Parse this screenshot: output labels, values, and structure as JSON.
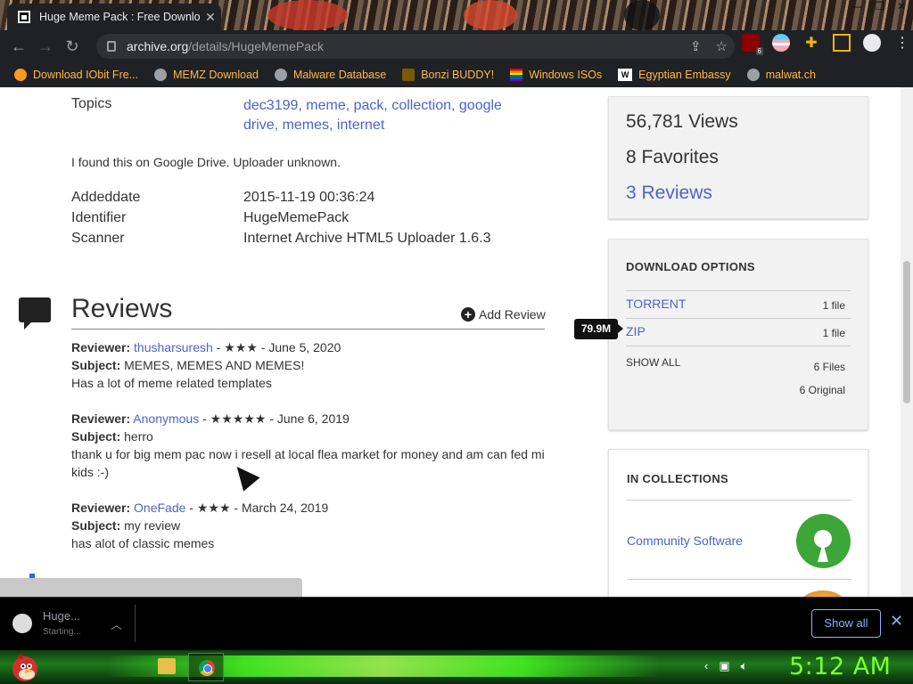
{
  "browser": {
    "tab_title": "Huge Meme Pack : Free Downloa",
    "tab_close": "✕",
    "url_host": "archive.org",
    "url_path": "/details/HugeMemePack",
    "ext_badge": "6"
  },
  "bookmarks": [
    {
      "label": "Download IObit Fre..."
    },
    {
      "label": "MEMZ Download"
    },
    {
      "label": "Malware Database"
    },
    {
      "label": "Bonzi BUDDY!"
    },
    {
      "label": "Windows ISOs"
    },
    {
      "label": "Egyptian Embassy"
    },
    {
      "label": "malwat.ch"
    }
  ],
  "meta": {
    "topics_label": "Topics",
    "topics": [
      "dec3199",
      "meme",
      "pack",
      "collection",
      "google drive",
      "memes",
      "internet"
    ],
    "description": "I found this on Google Drive. Uploader unknown.",
    "addeddate_label": "Addeddate",
    "addeddate": "2015-11-19 00:36:24",
    "identifier_label": "Identifier",
    "identifier": "HugeMemePack",
    "scanner_label": "Scanner",
    "scanner": "Internet Archive HTML5 Uploader 1.6.3"
  },
  "reviews": {
    "title": "Reviews",
    "add_label": "Add Review",
    "reviewer_label": "Reviewer:",
    "subject_label": "Subject:",
    "items": [
      {
        "reviewer": "thusharsuresh",
        "stars": "★★★",
        "date": "June 5, 2020",
        "subject": "MEMES, MEMES AND MEMES!",
        "body": "Has a lot of meme related templates"
      },
      {
        "reviewer": "Anonymous",
        "stars": "★★★★★",
        "date": "June 6, 2019",
        "subject": "herro",
        "body": "thank u for big mem pac now i resell at local flea market for money and am can fed mi kids :-)"
      },
      {
        "reviewer": "OneFade",
        "stars": "★★★",
        "date": "March 24, 2019",
        "subject": "my review",
        "body": "has alot of classic memes"
      }
    ]
  },
  "stats": {
    "views": "56,781 Views",
    "favorites": "8 Favorites",
    "reviews": "3 Reviews"
  },
  "download_options": {
    "header": "DOWNLOAD OPTIONS",
    "torrent": "TORRENT",
    "torrent_count": "1 file",
    "zip": "ZIP",
    "zip_count": "1 file",
    "zip_tooltip": "79.9M",
    "show_all": "SHOW ALL",
    "files": "6 Files",
    "original": "6 Original"
  },
  "collections": {
    "header": "IN COLLECTIONS",
    "item": "Community Software"
  },
  "download_shelf": {
    "file_name": "Huge...",
    "status": "Starting...",
    "show_all": "Show all"
  },
  "taskbar": {
    "clock": "5:12 AM"
  },
  "colors": {
    "link": "#4b64c8",
    "bookmark_text": "#ffb74d",
    "clock": "#7dff2e"
  }
}
